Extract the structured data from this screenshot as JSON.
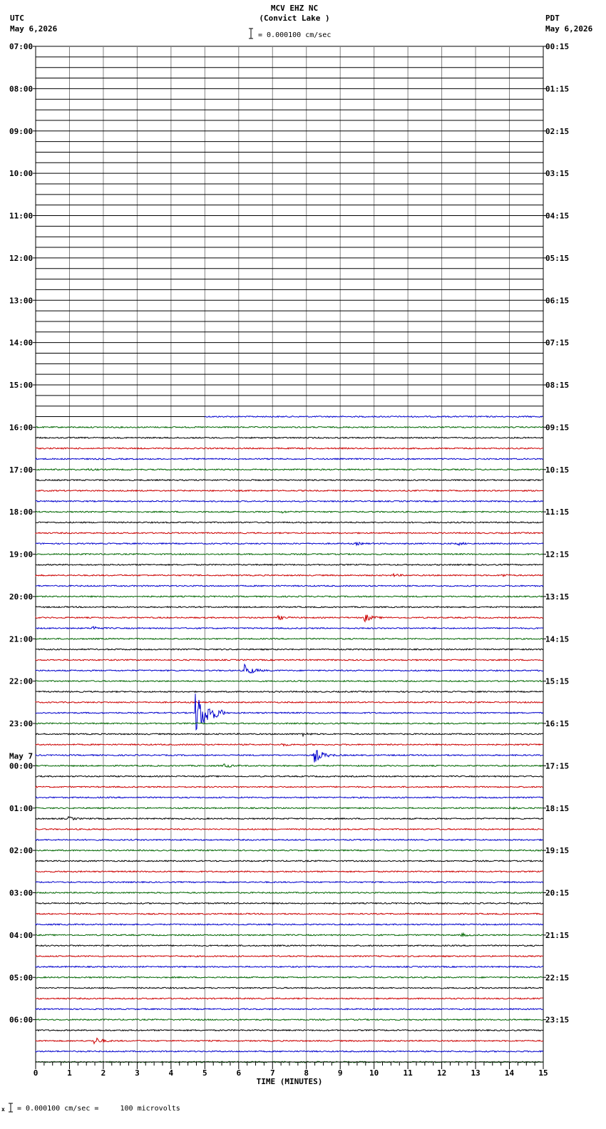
{
  "header": {
    "station": "MCV EHZ NC",
    "site": "(Convict Lake )",
    "scale_text": "= 0.000100 cm/sec",
    "left_tz": "UTC",
    "left_date": "May 6,2026",
    "right_tz": "PDT",
    "right_date": "May 6,2026"
  },
  "footer": {
    "scale_text": "= 0.000100 cm/sec =     100 microvolts"
  },
  "chart_data": {
    "type": "line",
    "title": "MCV EHZ NC (Convict Lake )",
    "xlabel": "TIME (MINUTES)",
    "xlim": [
      0,
      15
    ],
    "x_ticks": [
      "0",
      "1",
      "2",
      "3",
      "4",
      "5",
      "6",
      "7",
      "8",
      "9",
      "10",
      "11",
      "12",
      "13",
      "14",
      "15"
    ],
    "rows_per_hour": 4,
    "row_minutes": 15,
    "utc_labels": [
      "07:00",
      "08:00",
      "09:00",
      "10:00",
      "11:00",
      "12:00",
      "13:00",
      "14:00",
      "15:00",
      "16:00",
      "17:00",
      "18:00",
      "19:00",
      "20:00",
      "21:00",
      "22:00",
      "23:00",
      "00:00",
      "01:00",
      "02:00",
      "03:00",
      "04:00",
      "05:00",
      "06:00"
    ],
    "utc_date_change": {
      "label": "May 7",
      "at": "00:00"
    },
    "pdt_labels": [
      "00:15",
      "01:15",
      "02:15",
      "03:15",
      "04:15",
      "05:15",
      "06:15",
      "07:15",
      "08:15",
      "09:15",
      "10:15",
      "11:15",
      "12:15",
      "13:15",
      "14:15",
      "15:15",
      "16:15",
      "17:15",
      "18:15",
      "19:15",
      "20:15",
      "21:15",
      "22:15",
      "23:15"
    ],
    "trace_colors": [
      "#000000",
      "#cc0000",
      "#0000cc",
      "#006600"
    ],
    "data_start": {
      "row_utc": "15:30",
      "minute": 5
    },
    "events": [
      {
        "row_utc": "16:45",
        "minute": 1.6,
        "amp": 1.0
      },
      {
        "row_utc": "17:45",
        "minute": 7.3,
        "amp": 1.2
      },
      {
        "row_utc": "18:30",
        "minute": 9.5,
        "amp": 1.5
      },
      {
        "row_utc": "18:30",
        "minute": 12.5,
        "amp": 1.6
      },
      {
        "row_utc": "19:15",
        "minute": 10.6,
        "amp": 1.5
      },
      {
        "row_utc": "19:15",
        "minute": 13.8,
        "amp": 1.6
      },
      {
        "row_utc": "20:15",
        "minute": 7.2,
        "amp": 2.5
      },
      {
        "row_utc": "20:15",
        "minute": 9.75,
        "amp": 5.0
      },
      {
        "row_utc": "20:30",
        "minute": 1.7,
        "amp": 2.5
      },
      {
        "row_utc": "21:30",
        "minute": 6.2,
        "amp": 8.0
      },
      {
        "row_utc": "22:30",
        "minute": 4.75,
        "amp": 28.0
      },
      {
        "row_utc": "23:00",
        "minute": 7.9,
        "amp": 2.0
      },
      {
        "row_utc": "23:15",
        "minute": 7.3,
        "amp": 1.5
      },
      {
        "row_utc": "23:30",
        "minute": 8.25,
        "amp": 10.0
      },
      {
        "row_utc": "23:45",
        "minute": 5.6,
        "amp": 2.5
      },
      {
        "row_utc": "00:45",
        "minute": 14.0,
        "amp": 1.5
      },
      {
        "row_utc": "01:00",
        "minute": 1.0,
        "amp": 2.0
      },
      {
        "row_utc": "03:45",
        "minute": 12.6,
        "amp": 2.0
      },
      {
        "row_utc": "06:15",
        "minute": 1.75,
        "amp": 5.0
      }
    ]
  }
}
